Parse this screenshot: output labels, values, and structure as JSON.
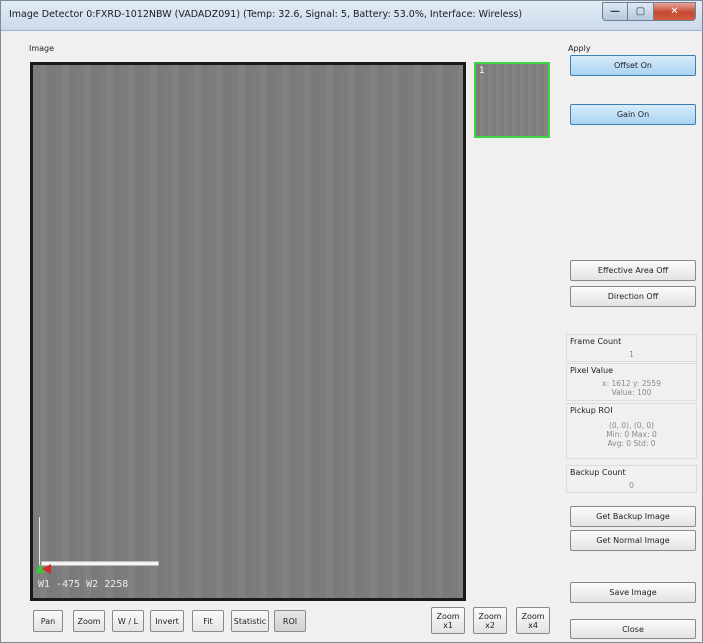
{
  "window": {
    "title": "Image Detector 0:FXRD-1012NBW (VADADZ091) (Temp: 32.6, Signal: 5, Battery: 53.0%, Interface: Wireless)",
    "controls": {
      "minimize": "—",
      "maximize": "▢",
      "close": "✕"
    }
  },
  "image_panel": {
    "label": "Image",
    "overlay_text": "W1 -475  W2 2258",
    "thumbnail_number": "1"
  },
  "apply_panel": {
    "label": "Apply",
    "offset_button": "Offset On",
    "gain_button": "Gain On",
    "effective_area_button": "Effective Area Off",
    "direction_button": "Direction Off"
  },
  "info": {
    "frame_count": {
      "title": "Frame Count",
      "value": "1"
    },
    "pixel_value": {
      "title": "Pixel Value",
      "coords": "x: 1612  y: 2559",
      "value": "Value: 100"
    },
    "pickup_roi": {
      "title": "Pickup ROI",
      "line1": "(0, 0), (0, 0)",
      "line2": "Min: 0 Max: 0",
      "line3": "Avg: 0 Std: 0"
    },
    "backup_count": {
      "title": "Backup Count",
      "value": "0"
    }
  },
  "actions": {
    "get_backup": "Get Backup Image",
    "get_normal": "Get Normal Image",
    "save": "Save Image",
    "close": "Close"
  },
  "toolbar": {
    "tools": [
      "Pan",
      "Zoom",
      "W / L",
      "Invert",
      "Fit",
      "Statistic",
      "ROI"
    ],
    "zoom": [
      "Zoom\nx1",
      "Zoom\nx2",
      "Zoom\nx4"
    ]
  }
}
